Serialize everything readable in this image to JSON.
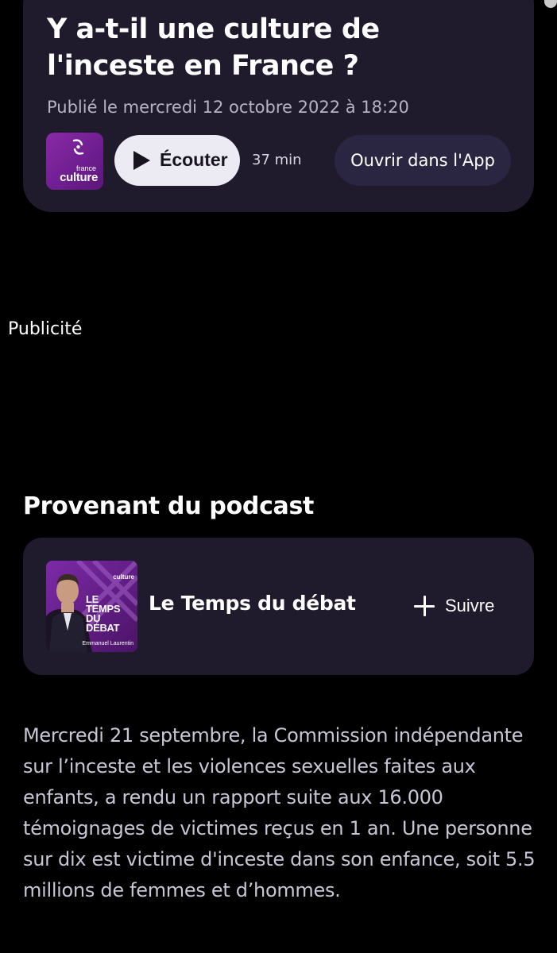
{
  "episode": {
    "title": "Y a-t-il une culture de l'inceste en France ?",
    "published": "Publié le mercredi 12 octobre 2022 à 18:20",
    "station_logo": {
      "small_text": "france",
      "big_text": "culture",
      "brand_color": "#7a23a0"
    },
    "listen_label": "Écouter",
    "duration": "37 min",
    "open_app_label": "Ouvrir dans l'App"
  },
  "ad": {
    "label": "Publicité"
  },
  "podcast_section": {
    "title": "Provenant du podcast",
    "podcast": {
      "name": "Le Temps du débat",
      "follow_label": "Suivre",
      "cover": {
        "brand": "culture",
        "title_lines": [
          "LE",
          "TEMPS",
          "DU",
          "DÉBAT"
        ],
        "host": "Emmanuel Laurentin"
      }
    }
  },
  "description": "Mercredi 21 septembre, la Commission indépendante sur l’inceste et les violences sexuelles faites aux enfants, a rendu un rapport suite aux 16.000 témoignages de victimes reçus en 1 an. Une personne sur dix est victime d'inceste dans son enfance, soit 5.5 millions de femmes et d’hommes.",
  "colors": {
    "background": "#000000",
    "card": "#1f1b2d",
    "secondary_button": "#2a2540",
    "primary_button": "#eceaf3",
    "muted_text": "#b7b3c4"
  }
}
